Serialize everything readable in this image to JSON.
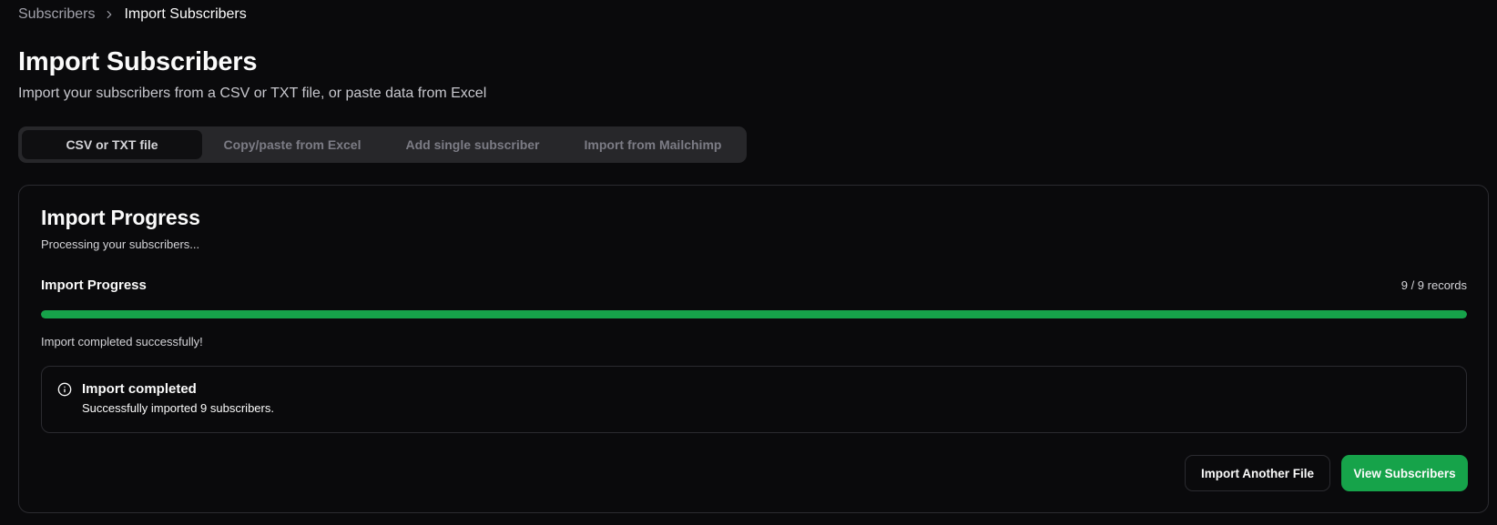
{
  "breadcrumb": {
    "parent": "Subscribers",
    "current": "Import Subscribers"
  },
  "header": {
    "title": "Import Subscribers",
    "subtitle": "Import your subscribers from a CSV or TXT file, or paste data from Excel"
  },
  "tabs": [
    {
      "label": "CSV or TXT file",
      "active": true
    },
    {
      "label": "Copy/paste from Excel",
      "active": false
    },
    {
      "label": "Add single subscriber",
      "active": false
    },
    {
      "label": "Import from Mailchimp",
      "active": false
    }
  ],
  "card": {
    "title": "Import Progress",
    "description": "Processing your subscribers...",
    "progress": {
      "label": "Import Progress",
      "count": "9 / 9 records",
      "completed": 9,
      "total": 9,
      "fraction": 1.0
    },
    "status": "Import completed successfully!",
    "alert": {
      "icon": "info-icon",
      "title": "Import completed",
      "description": "Successfully imported 9 subscribers."
    },
    "buttons": {
      "secondary": "Import Another File",
      "primary": "View Subscribers"
    }
  },
  "colors": {
    "background": "#0a0a0c",
    "accent": "#16a34a",
    "border": "#2b2b30",
    "tab_bar": "#27272a"
  }
}
